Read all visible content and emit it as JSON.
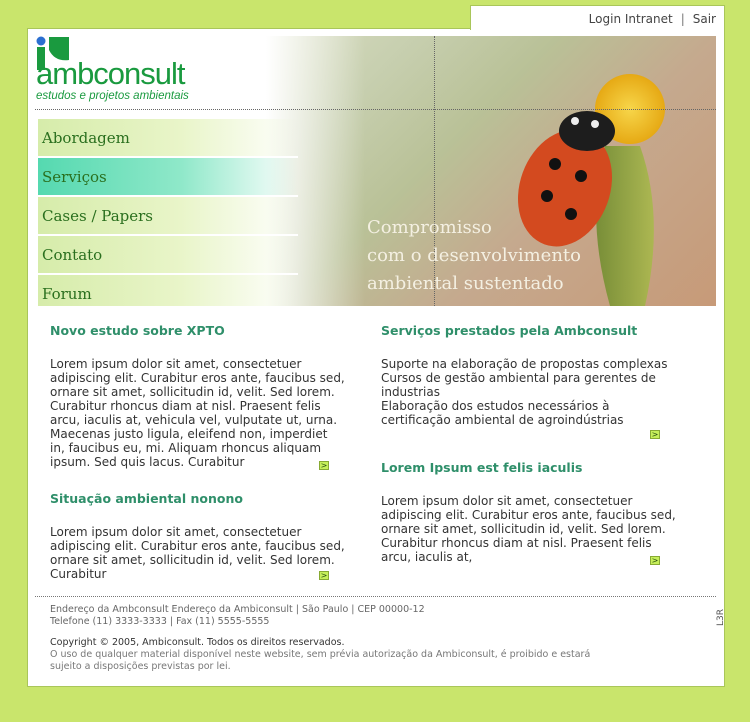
{
  "topbar": {
    "login": "Login Intranet",
    "separator": "|",
    "logout": "Sair"
  },
  "logo": {
    "name": "ambconsult",
    "tagline": "estudos e projetos ambientais"
  },
  "nav": [
    {
      "label": "Abordagem",
      "active": false
    },
    {
      "label": "Serviços",
      "active": true
    },
    {
      "label": "Cases / Papers",
      "active": false
    },
    {
      "label": "Contato",
      "active": false
    },
    {
      "label": "Forum",
      "active": false
    }
  ],
  "tagline": {
    "line1": "Compromisso",
    "line2": "com o desenvolvimento",
    "line3": "ambiental sustentado"
  },
  "left": {
    "news1": {
      "title": "Novo estudo sobre XPTO",
      "body": "Lorem ipsum dolor sit amet, consectetuer adipiscing elit. Curabitur eros ante, faucibus sed, ornare sit amet, sollicitudin id, velit. Sed lorem. Curabitur rhoncus diam at nisl. Praesent felis arcu, iaculis at, vehicula vel, vulputate ut, urna. Maecenas justo ligula, eleifend non, imperdiet in, faucibus eu, mi. Aliquam rhoncus aliquam ipsum. Sed quis lacus. Curabitur"
    },
    "news2": {
      "title": "Situação ambiental nonono",
      "body": "Lorem ipsum dolor sit amet, consectetuer adipiscing elit. Curabitur eros ante, faucibus sed, ornare sit amet, sollicitudin id, velit. Sed lorem. Curabitur"
    }
  },
  "right": {
    "services": {
      "title": "Serviços prestados pela Ambconsult",
      "lines": [
        "Suporte na elaboração de propostas complexas",
        "Cursos de gestão ambiental para gerentes de industrias",
        "Elaboração dos estudos necessários à certificação ambiental de agroindústrias"
      ]
    },
    "news3": {
      "title": "Lorem Ipsum est felis iaculis",
      "body": "Lorem ipsum dolor sit amet, consectetuer adipiscing elit. Curabitur eros ante, faucibus sed, ornare sit amet, sollicitudin id, velit. Sed lorem. Curabitur rhoncus diam at nisl. Praesent felis arcu, iaculis at,"
    }
  },
  "more_label": ">",
  "footer": {
    "address": "Endereço da Ambconsult Endereço da Ambiconsult  |  São Paulo | CEP 00000-12",
    "phone": "Telefone (11) 3333-3333  |  Fax (11) 5555-5555",
    "copyright": "Copyright © 2005, Ambiconsult. Todos os direitos reservados.",
    "notice": "O uso de qualquer material disponível neste website, sem prévia autorização da Ambiconsult, é proibido e estará sujeito a disposições previstas por lei.",
    "credit": "L3R"
  },
  "colors": {
    "background": "#c9e56c",
    "brand": "#1a9a3f",
    "heading": "#2f8f6a",
    "nav_active": "#55d9b0"
  }
}
